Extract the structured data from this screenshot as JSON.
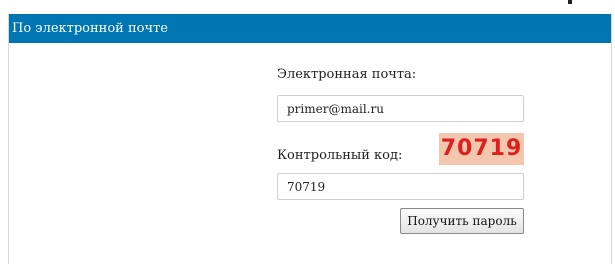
{
  "panel": {
    "title": "По электронной почте"
  },
  "form": {
    "email_label": "Электронная почта:",
    "email_value": "primer@mail.ru",
    "code_label": "Контрольный код:",
    "captcha_text": "70719",
    "code_value": "70719",
    "submit_label": "Получить пароль"
  },
  "colors": {
    "header_bg": "#0075b3",
    "captcha_bg": "#f3c7ad",
    "captcha_text": "#dd1f1f"
  }
}
